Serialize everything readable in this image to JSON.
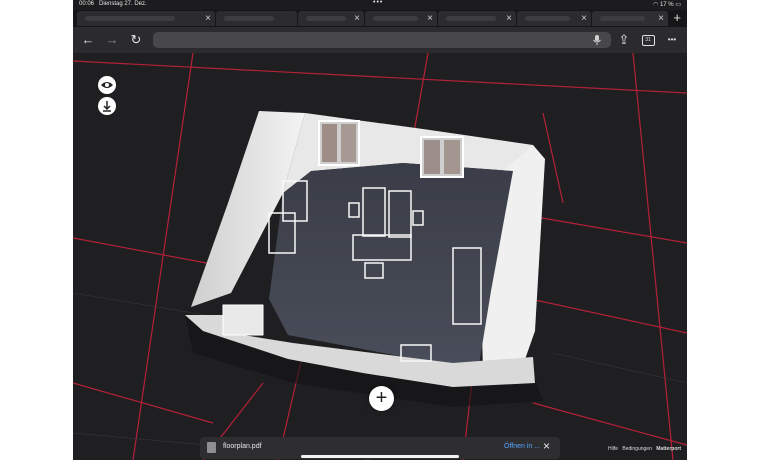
{
  "status_bar": {
    "time": "00:06",
    "date": "Dienstag 27. Dez.",
    "dots": "•••",
    "battery": "17 %"
  },
  "tabs": [
    {
      "close": "×"
    },
    {
      "close": "×"
    },
    {
      "close": "×"
    },
    {
      "close": "×"
    },
    {
      "close": "×"
    },
    {
      "close": "×"
    }
  ],
  "new_tab": "+",
  "toolbar": {
    "back": "←",
    "forward": "→",
    "reload": "↻",
    "share": "⇪",
    "tabs_count": "31",
    "more": "•••"
  },
  "viewer": {
    "add": "+"
  },
  "download_bar": {
    "file_name": "floorplan.pdf",
    "open_label": "Öffnen in ...",
    "close": "×"
  },
  "footer": {
    "help": "Hilfe",
    "terms": "Bedingungen",
    "brand": "Matterport"
  },
  "colors": {
    "grid_line": "#c4213a",
    "background": "#1f1f22",
    "accent_link": "#5aa4ff"
  }
}
